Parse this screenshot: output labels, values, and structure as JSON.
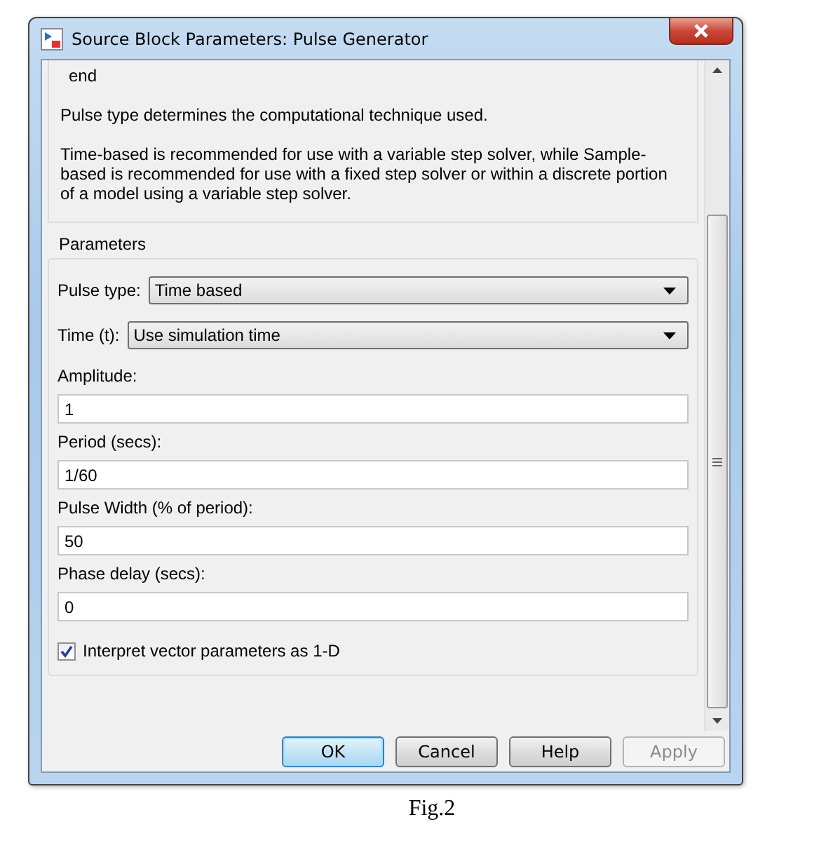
{
  "window": {
    "title": "Source Block Parameters: Pulse Generator"
  },
  "description": [
    {
      "kind": "code",
      "text": "end"
    },
    {
      "kind": "text",
      "text": "Pulse type determines the computational technique used."
    },
    {
      "kind": "text",
      "text": "Time-based is recommended for use with a variable step solver, while Sample-based is recommended for use with a fixed step solver or within a discrete portion of a model using a variable step solver."
    }
  ],
  "parameters": {
    "title": "Parameters",
    "fields": [
      {
        "kind": "dropdown",
        "label": "Pulse type:",
        "value": "Time based"
      },
      {
        "kind": "dropdown",
        "label": "Time (t):",
        "value": "Use simulation time"
      },
      {
        "kind": "text",
        "label": "Amplitude:",
        "value": "1"
      },
      {
        "kind": "text",
        "label": "Period (secs):",
        "value": "1/60"
      },
      {
        "kind": "text",
        "label": "Pulse Width (% of period):",
        "value": "50"
      },
      {
        "kind": "text",
        "label": "Phase delay (secs):",
        "value": "0"
      },
      {
        "kind": "checkbox",
        "label": "Interpret vector parameters as 1-D",
        "checked": true
      }
    ]
  },
  "buttons": [
    {
      "label": "OK",
      "default": true,
      "disabled": false
    },
    {
      "label": "Cancel",
      "default": false,
      "disabled": false
    },
    {
      "label": "Help",
      "default": false,
      "disabled": false
    },
    {
      "label": "Apply",
      "default": false,
      "disabled": true
    }
  ],
  "caption": "Fig.2"
}
